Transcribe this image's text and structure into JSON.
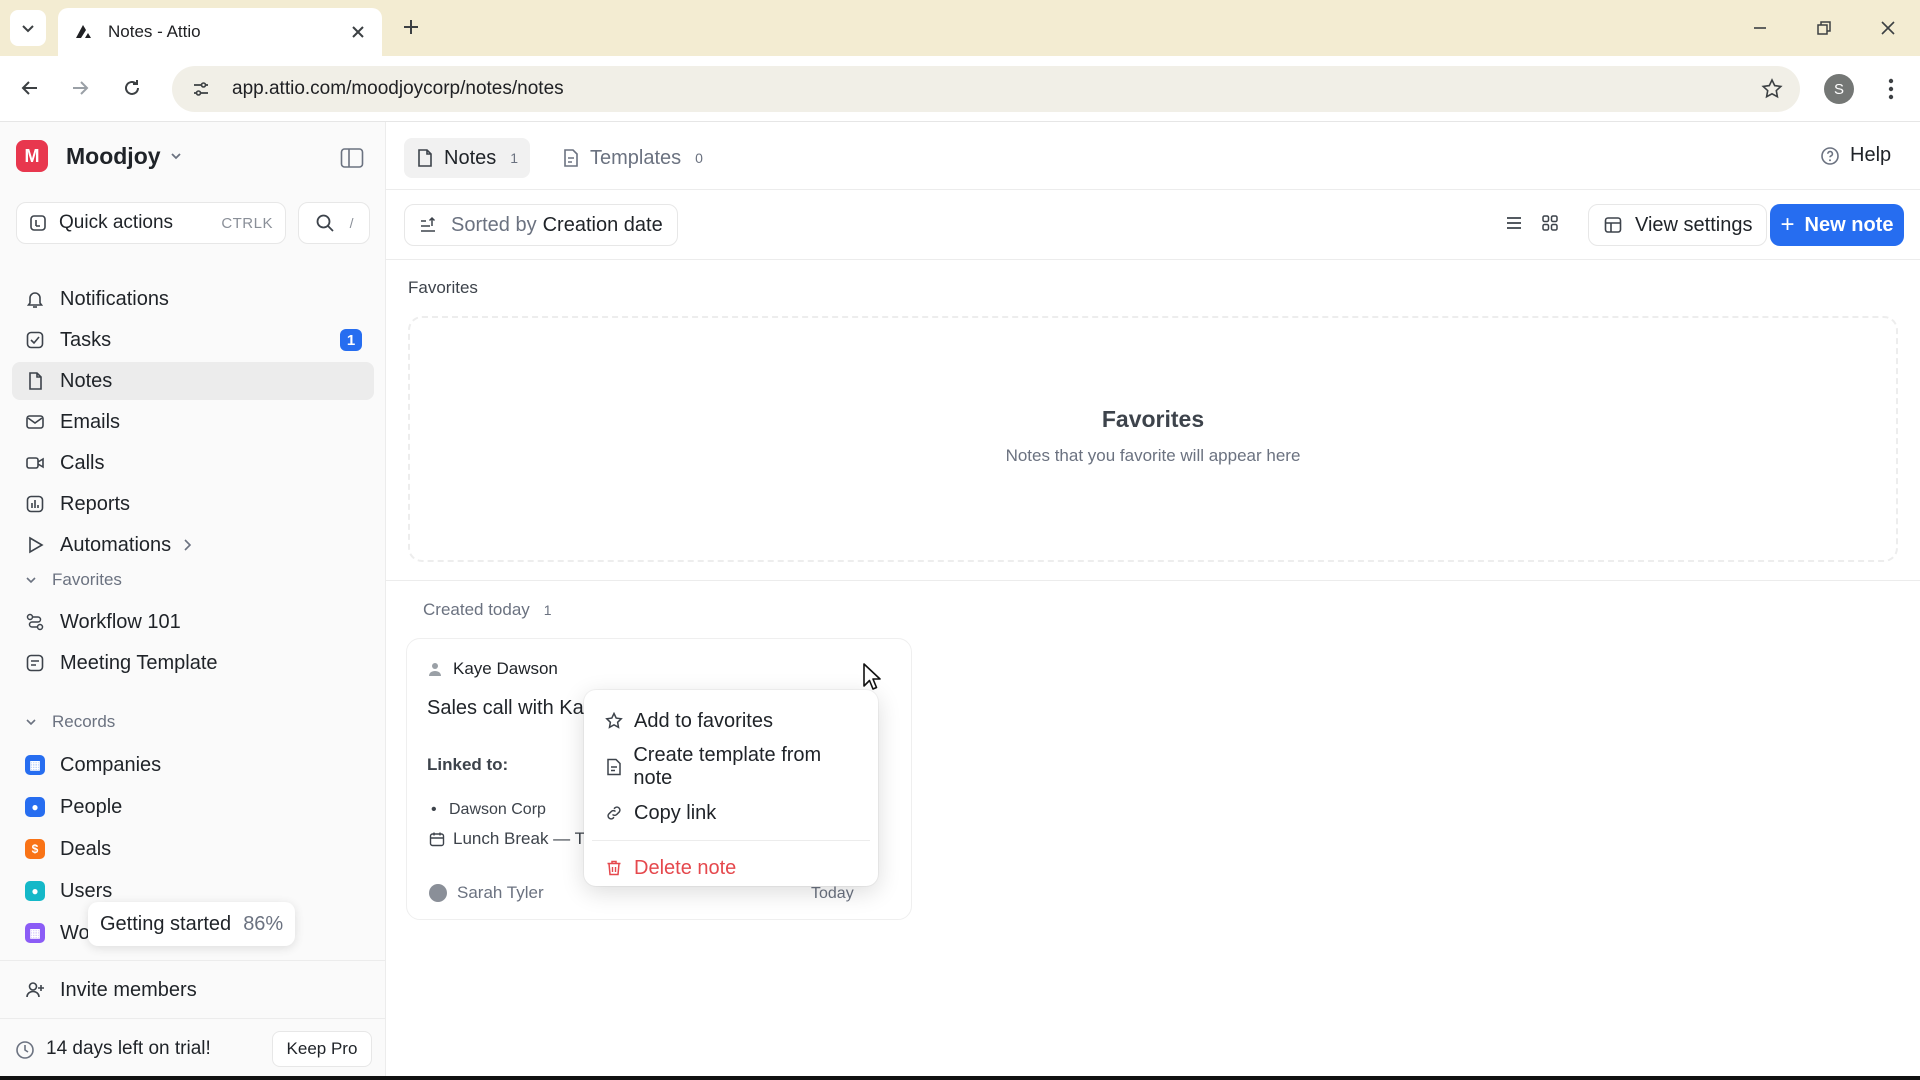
{
  "browser": {
    "tab_title": "Notes - Attio",
    "url": "app.attio.com/moodjoycorp/notes/notes",
    "profile_initial": "S"
  },
  "workspace": {
    "initial": "M",
    "name": "Moodjoy"
  },
  "sidebar": {
    "quick_actions": {
      "label": "Quick actions",
      "shortcut": "CTRLK"
    },
    "search_slash": "/",
    "nav": [
      {
        "label": "Notifications",
        "icon": "bell-icon"
      },
      {
        "label": "Tasks",
        "icon": "task-check-icon",
        "badge": "1"
      },
      {
        "label": "Notes",
        "icon": "note-icon",
        "active": true
      },
      {
        "label": "Emails",
        "icon": "mail-icon"
      },
      {
        "label": "Calls",
        "icon": "video-icon"
      },
      {
        "label": "Reports",
        "icon": "chart-icon"
      },
      {
        "label": "Automations",
        "icon": "play-icon"
      }
    ],
    "favorites_header": "Favorites",
    "favorites": [
      {
        "label": "Workflow 101",
        "icon": "workflow-icon"
      },
      {
        "label": "Meeting Template",
        "icon": "template-icon"
      }
    ],
    "records_header": "Records",
    "records": [
      {
        "label": "Companies",
        "icon": "companies-icon",
        "color": "#266df0"
      },
      {
        "label": "People",
        "icon": "people-icon",
        "color": "#266df0"
      },
      {
        "label": "Deals",
        "icon": "deals-icon",
        "color": "#f97316"
      },
      {
        "label": "Users",
        "icon": "users-icon",
        "color": "#14b8c8"
      },
      {
        "label": "Wor",
        "icon": "workspaces-icon",
        "color": "#8b5cf6"
      }
    ],
    "getting_started": {
      "label": "Getting started",
      "percent": "86%"
    },
    "invite": "Invite members",
    "trial": {
      "label": "14 days left on trial!",
      "button": "Keep Pro"
    }
  },
  "main": {
    "tabs": [
      {
        "label": "Notes",
        "count": "1"
      },
      {
        "label": "Templates",
        "count": "0"
      }
    ],
    "help": "Help",
    "sort": {
      "prefix": "Sorted by",
      "value": "Creation date"
    },
    "view_settings": "View settings",
    "new_note": "New note",
    "favorites_label": "Favorites",
    "favorites_empty": {
      "title": "Favorites",
      "subtitle": "Notes that you favorite will appear here"
    },
    "created": {
      "label": "Created today",
      "count": "1"
    },
    "note_card": {
      "author": "Kaye Dawson",
      "title": "Sales call with Ka",
      "linked_label": "Linked to:",
      "linked_item": "Dawson Corp",
      "event": "Lunch Break — T",
      "owner": "Sarah Tyler",
      "date": "Today"
    },
    "context_menu": [
      {
        "label": "Add to favorites",
        "icon": "star-icon"
      },
      {
        "label": "Create template from note",
        "icon": "template-icon"
      },
      {
        "label": "Copy link",
        "icon": "link-icon"
      },
      {
        "label": "Delete note",
        "icon": "trash-icon",
        "danger": true
      }
    ]
  },
  "colors": {
    "accent": "#266df0",
    "brand": "#e8374e",
    "danger": "#e5484d"
  }
}
